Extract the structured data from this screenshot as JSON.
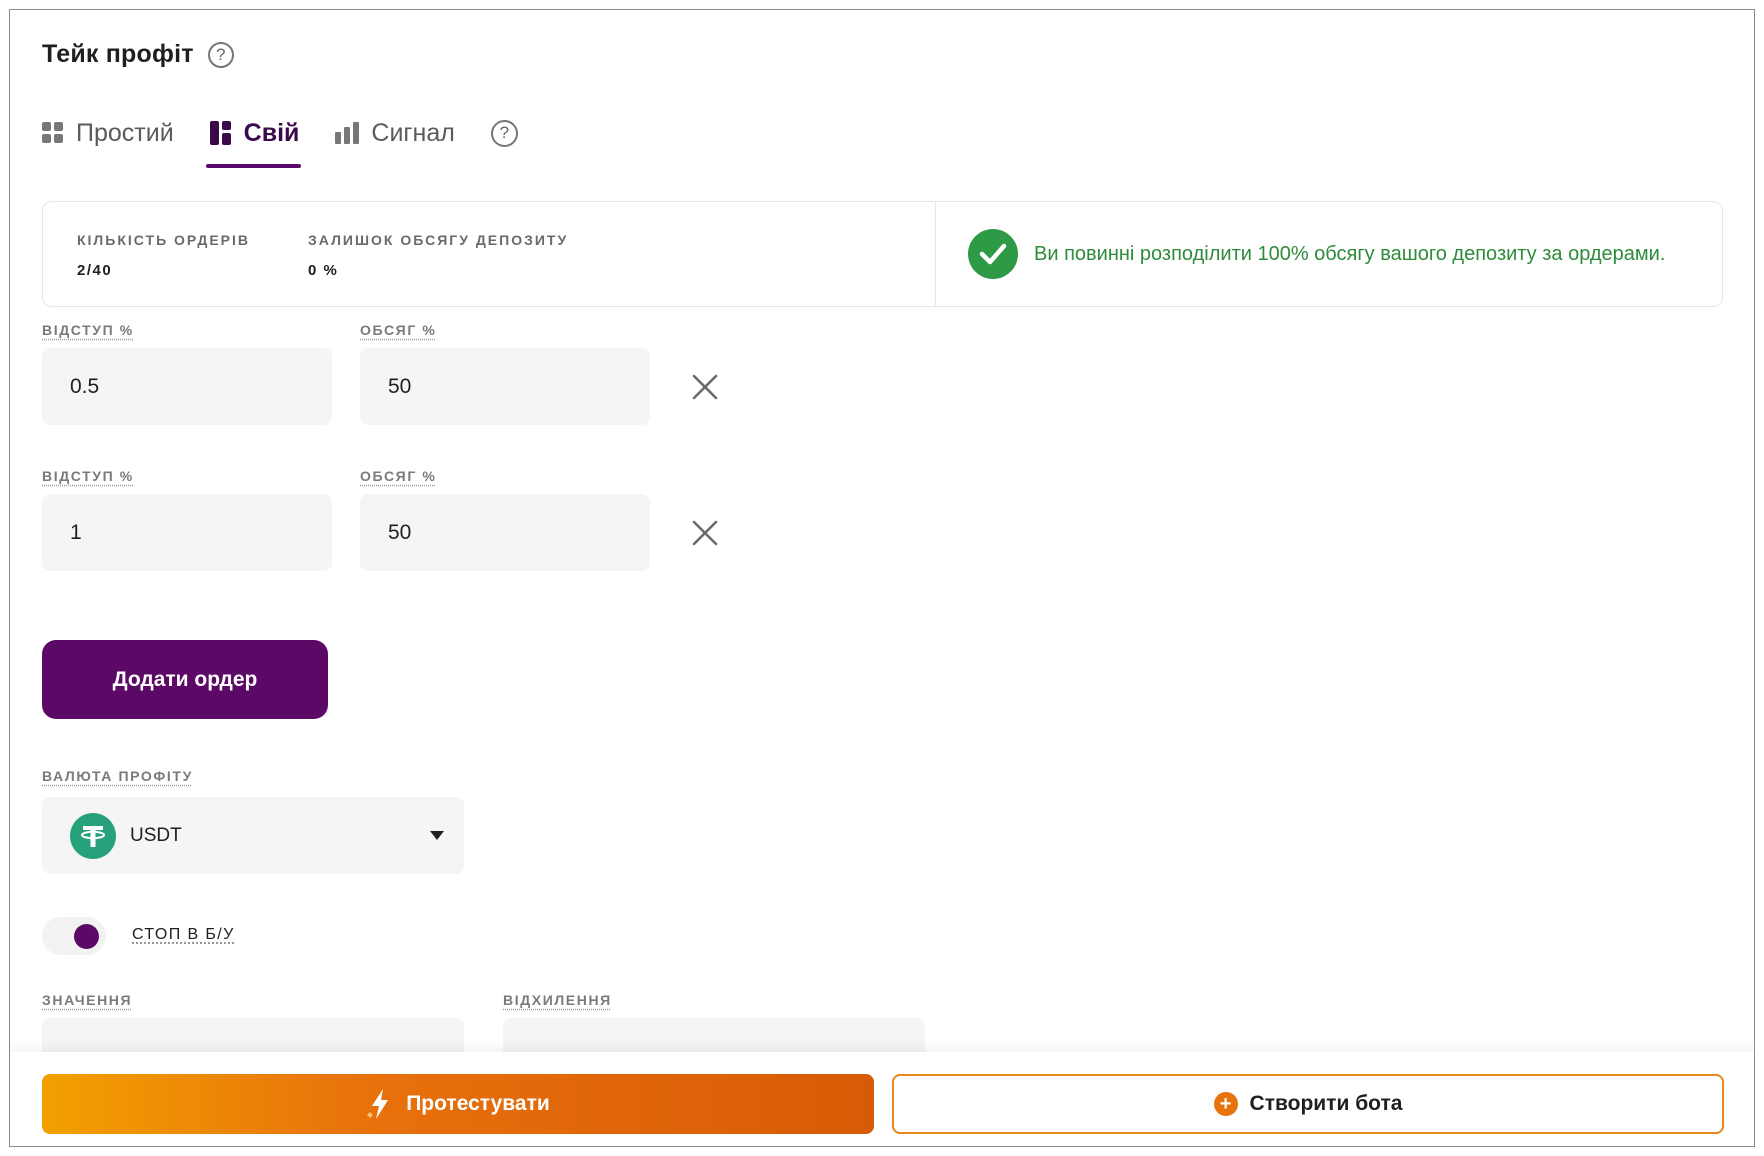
{
  "header": {
    "title": "Тейк профіт"
  },
  "tabs": [
    {
      "label": "Простий",
      "icon": "grid-icon",
      "active": false
    },
    {
      "label": "Свій",
      "icon": "layout-icon",
      "active": true
    },
    {
      "label": "Сигнал",
      "icon": "bar-chart-icon",
      "active": false
    }
  ],
  "summary": {
    "orders_label": "КІЛЬКІСТЬ ОРДЕРІВ",
    "orders_value": "2/40",
    "remaining_label": "ЗАЛИШОК ОБСЯГУ ДЕПОЗИТУ",
    "remaining_value": "0 %",
    "message": "Ви повинні розподілити 100% обсягу вашого депозиту за ордерами."
  },
  "orders": [
    {
      "offset_label": "ВІДСТУП %",
      "offset_value": "0.5",
      "volume_label": "ОБСЯГ %",
      "volume_value": "50"
    },
    {
      "offset_label": "ВІДСТУП %",
      "offset_value": "1",
      "volume_label": "ОБСЯГ %",
      "volume_value": "50"
    }
  ],
  "add_order_label": "Додати ордер",
  "profit_currency": {
    "label": "ВАЛЮТА ПРОФІТУ",
    "value": "USDT",
    "icon": "tether-icon"
  },
  "stop_breakeven": {
    "label": "СТОП В Б/У",
    "enabled": true
  },
  "value_field": {
    "label": "ЗНАЧЕННЯ"
  },
  "deviation_field": {
    "label": "ВІДХИЛЕННЯ"
  },
  "footer": {
    "test_label": "Протестувати",
    "create_label": "Створити бота"
  },
  "colors": {
    "accent": "#5c0866",
    "success": "#2e9a45",
    "orange": "#e8730c"
  }
}
